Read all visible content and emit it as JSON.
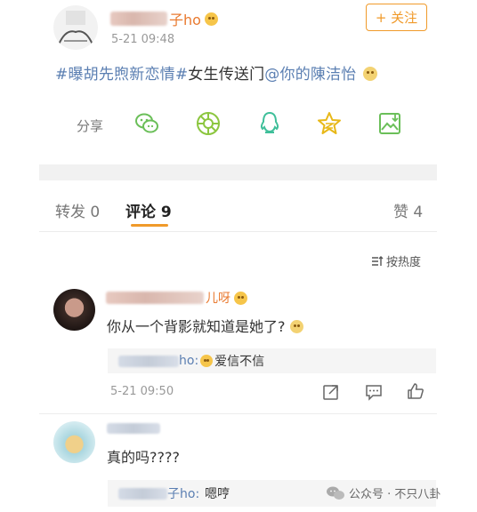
{
  "post": {
    "author_suffix": "子ho",
    "time": "5-21 09:48",
    "follow_label": "+ 关注",
    "topic1": "#曝胡先煦新恋情#",
    "text_mid": "女生传送门",
    "mention": "@你的陳洁怡"
  },
  "share": {
    "label": "分享",
    "targets": [
      "wechat-icon",
      "moments-icon",
      "qq-icon",
      "qzone-icon",
      "save-image-icon"
    ]
  },
  "tabs": {
    "repost": "转发 0",
    "comments": "评论 9",
    "likes": "赞 4"
  },
  "sort_label": "按热度",
  "comments": [
    {
      "author_suffix": "儿呀",
      "text": "你从一个背影就知道是她了?",
      "reply_suffix": "ho:",
      "reply_text": "爱信不信",
      "time": "5-21 09:50"
    },
    {
      "text": "真的吗????",
      "reply_suffix": "子ho:",
      "reply_text": "嗯哼"
    }
  ],
  "watermark": "公众号 · 不只八卦",
  "colors": {
    "link": "#5b7fb2",
    "accent": "#f09a2a",
    "share_green": "#6bbf59",
    "share_teal": "#3fbf9a",
    "share_gold": "#e8b818"
  }
}
